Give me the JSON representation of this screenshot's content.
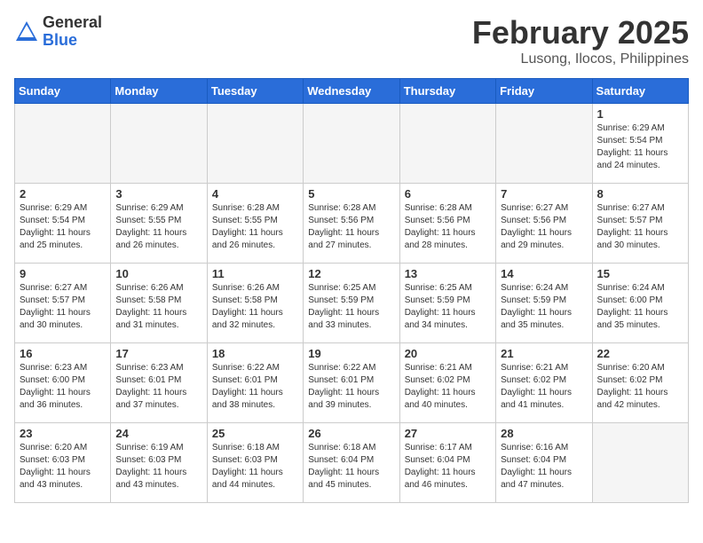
{
  "logo": {
    "general": "General",
    "blue": "Blue"
  },
  "title": "February 2025",
  "subtitle": "Lusong, Ilocos, Philippines",
  "days_of_week": [
    "Sunday",
    "Monday",
    "Tuesday",
    "Wednesday",
    "Thursday",
    "Friday",
    "Saturday"
  ],
  "weeks": [
    [
      {
        "num": "",
        "info": "",
        "empty": true
      },
      {
        "num": "",
        "info": "",
        "empty": true
      },
      {
        "num": "",
        "info": "",
        "empty": true
      },
      {
        "num": "",
        "info": "",
        "empty": true
      },
      {
        "num": "",
        "info": "",
        "empty": true
      },
      {
        "num": "",
        "info": "",
        "empty": true
      },
      {
        "num": "1",
        "info": "Sunrise: 6:29 AM\nSunset: 5:54 PM\nDaylight: 11 hours and 24 minutes.",
        "empty": false
      }
    ],
    [
      {
        "num": "2",
        "info": "Sunrise: 6:29 AM\nSunset: 5:54 PM\nDaylight: 11 hours and 25 minutes.",
        "empty": false
      },
      {
        "num": "3",
        "info": "Sunrise: 6:29 AM\nSunset: 5:55 PM\nDaylight: 11 hours and 26 minutes.",
        "empty": false
      },
      {
        "num": "4",
        "info": "Sunrise: 6:28 AM\nSunset: 5:55 PM\nDaylight: 11 hours and 26 minutes.",
        "empty": false
      },
      {
        "num": "5",
        "info": "Sunrise: 6:28 AM\nSunset: 5:56 PM\nDaylight: 11 hours and 27 minutes.",
        "empty": false
      },
      {
        "num": "6",
        "info": "Sunrise: 6:28 AM\nSunset: 5:56 PM\nDaylight: 11 hours and 28 minutes.",
        "empty": false
      },
      {
        "num": "7",
        "info": "Sunrise: 6:27 AM\nSunset: 5:56 PM\nDaylight: 11 hours and 29 minutes.",
        "empty": false
      },
      {
        "num": "8",
        "info": "Sunrise: 6:27 AM\nSunset: 5:57 PM\nDaylight: 11 hours and 30 minutes.",
        "empty": false
      }
    ],
    [
      {
        "num": "9",
        "info": "Sunrise: 6:27 AM\nSunset: 5:57 PM\nDaylight: 11 hours and 30 minutes.",
        "empty": false
      },
      {
        "num": "10",
        "info": "Sunrise: 6:26 AM\nSunset: 5:58 PM\nDaylight: 11 hours and 31 minutes.",
        "empty": false
      },
      {
        "num": "11",
        "info": "Sunrise: 6:26 AM\nSunset: 5:58 PM\nDaylight: 11 hours and 32 minutes.",
        "empty": false
      },
      {
        "num": "12",
        "info": "Sunrise: 6:25 AM\nSunset: 5:59 PM\nDaylight: 11 hours and 33 minutes.",
        "empty": false
      },
      {
        "num": "13",
        "info": "Sunrise: 6:25 AM\nSunset: 5:59 PM\nDaylight: 11 hours and 34 minutes.",
        "empty": false
      },
      {
        "num": "14",
        "info": "Sunrise: 6:24 AM\nSunset: 5:59 PM\nDaylight: 11 hours and 35 minutes.",
        "empty": false
      },
      {
        "num": "15",
        "info": "Sunrise: 6:24 AM\nSunset: 6:00 PM\nDaylight: 11 hours and 35 minutes.",
        "empty": false
      }
    ],
    [
      {
        "num": "16",
        "info": "Sunrise: 6:23 AM\nSunset: 6:00 PM\nDaylight: 11 hours and 36 minutes.",
        "empty": false
      },
      {
        "num": "17",
        "info": "Sunrise: 6:23 AM\nSunset: 6:01 PM\nDaylight: 11 hours and 37 minutes.",
        "empty": false
      },
      {
        "num": "18",
        "info": "Sunrise: 6:22 AM\nSunset: 6:01 PM\nDaylight: 11 hours and 38 minutes.",
        "empty": false
      },
      {
        "num": "19",
        "info": "Sunrise: 6:22 AM\nSunset: 6:01 PM\nDaylight: 11 hours and 39 minutes.",
        "empty": false
      },
      {
        "num": "20",
        "info": "Sunrise: 6:21 AM\nSunset: 6:02 PM\nDaylight: 11 hours and 40 minutes.",
        "empty": false
      },
      {
        "num": "21",
        "info": "Sunrise: 6:21 AM\nSunset: 6:02 PM\nDaylight: 11 hours and 41 minutes.",
        "empty": false
      },
      {
        "num": "22",
        "info": "Sunrise: 6:20 AM\nSunset: 6:02 PM\nDaylight: 11 hours and 42 minutes.",
        "empty": false
      }
    ],
    [
      {
        "num": "23",
        "info": "Sunrise: 6:20 AM\nSunset: 6:03 PM\nDaylight: 11 hours and 43 minutes.",
        "empty": false
      },
      {
        "num": "24",
        "info": "Sunrise: 6:19 AM\nSunset: 6:03 PM\nDaylight: 11 hours and 43 minutes.",
        "empty": false
      },
      {
        "num": "25",
        "info": "Sunrise: 6:18 AM\nSunset: 6:03 PM\nDaylight: 11 hours and 44 minutes.",
        "empty": false
      },
      {
        "num": "26",
        "info": "Sunrise: 6:18 AM\nSunset: 6:04 PM\nDaylight: 11 hours and 45 minutes.",
        "empty": false
      },
      {
        "num": "27",
        "info": "Sunrise: 6:17 AM\nSunset: 6:04 PM\nDaylight: 11 hours and 46 minutes.",
        "empty": false
      },
      {
        "num": "28",
        "info": "Sunrise: 6:16 AM\nSunset: 6:04 PM\nDaylight: 11 hours and 47 minutes.",
        "empty": false
      },
      {
        "num": "",
        "info": "",
        "empty": true
      }
    ]
  ]
}
